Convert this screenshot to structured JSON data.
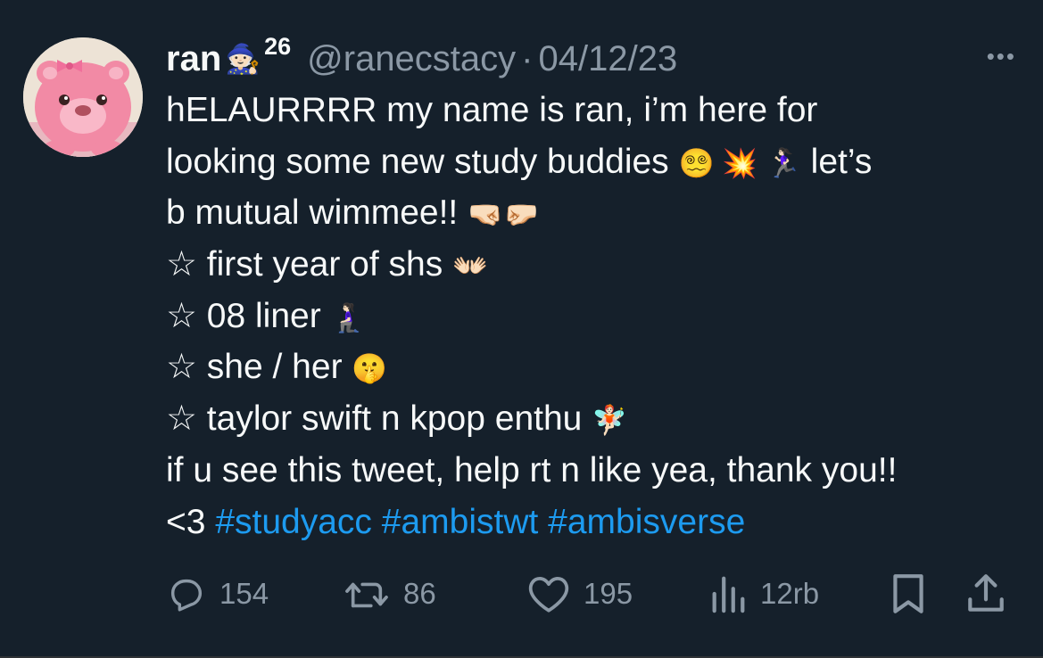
{
  "user": {
    "name": "ran",
    "badge_emoji": "🧙🏻",
    "badge_number": "26",
    "handle": "@ranecstacy",
    "separator": "·",
    "date": "04/12/23"
  },
  "more_label": "•••",
  "body": {
    "line1": "hELAURRRR my name is ran, i’m here for",
    "line2_text": "looking some new study buddies ",
    "line2_emojis": "😵‍💫 💥 🏃🏻‍♀️",
    "line2_end": " let’s",
    "line3_text": "b mutual wimmee!! ",
    "line3_emojis": "🤜🏻🤛🏻",
    "line4_text": "☆ first year of shs ",
    "line4_emoji": "👐🏻",
    "line5_text": "☆ 08 liner ",
    "line5_emoji": "🧎🏻‍♀️",
    "line6_text": "☆ she / her ",
    "line6_emoji": "🤫",
    "line7_text": "☆ taylor swift n kpop enthu ",
    "line7_emoji": "🧚🏻",
    "line8": "if u see this tweet, help rt n like yea, thank you!!",
    "line9_text": "<3 ",
    "hashtags": [
      "#studyacc",
      "#ambistwt",
      "#ambisverse"
    ]
  },
  "actions": {
    "replies": "154",
    "retweets": "86",
    "likes": "195",
    "views": "12rb"
  },
  "icons": {
    "reply": "reply-icon",
    "retweet": "retweet-icon",
    "like": "heart-icon",
    "views": "views-icon",
    "bookmark": "bookmark-icon",
    "share": "share-icon"
  },
  "colors": {
    "background": "#15202b",
    "text": "#f7f9f9",
    "muted": "#8b98a5",
    "link": "#1d9bf0"
  }
}
